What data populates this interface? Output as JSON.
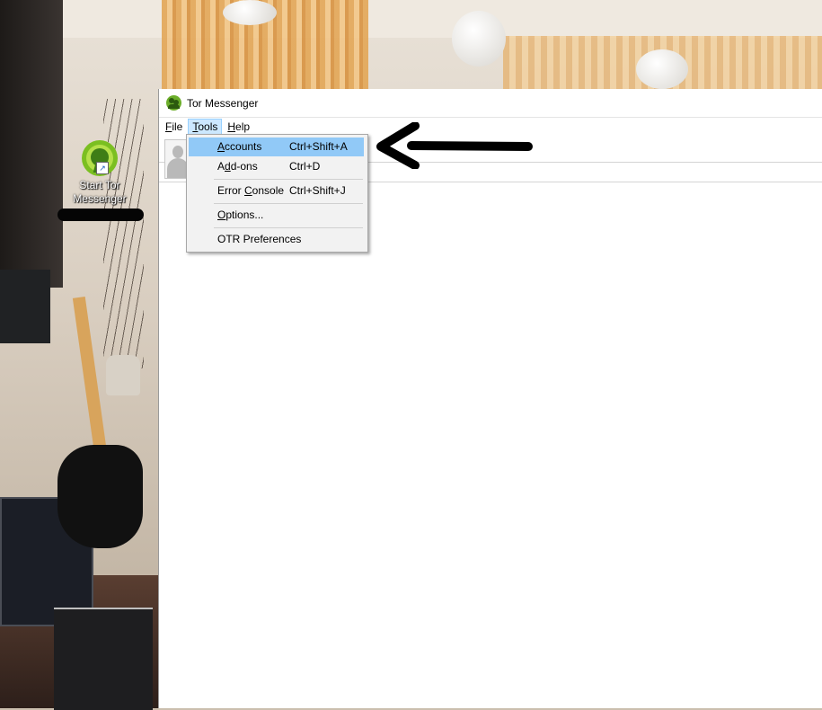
{
  "desktop": {
    "shortcut_label": "Start Tor Messenger"
  },
  "window": {
    "title": "Tor Messenger",
    "menu": {
      "file_prefix": "",
      "file_u": "F",
      "file_rest": "ile",
      "tools_u": "T",
      "tools_rest": "ools",
      "help_u": "H",
      "help_rest": "elp"
    }
  },
  "tools_menu": {
    "items": [
      {
        "pre": "",
        "u": "A",
        "post": "ccounts",
        "shortcut": "Ctrl+Shift+A",
        "highlighted": true
      },
      {
        "pre": "A",
        "u": "d",
        "post": "d-ons",
        "shortcut": "Ctrl+D"
      },
      {
        "pre": "Error ",
        "u": "C",
        "post": "onsole",
        "shortcut": "Ctrl+Shift+J"
      },
      {
        "pre": "",
        "u": "O",
        "post": "ptions...",
        "shortcut": ""
      },
      {
        "pre": "OTR Preferences",
        "u": "",
        "post": "",
        "shortcut": ""
      }
    ]
  },
  "colors": {
    "highlight": "#91c9f7",
    "active_menu": "#cce8ff",
    "tor_green": "#7bbf21"
  }
}
